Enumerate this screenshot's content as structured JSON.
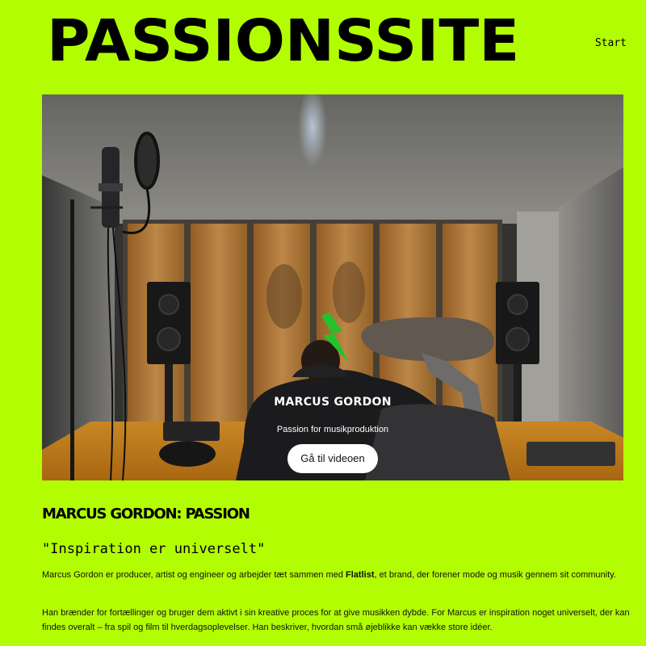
{
  "header": {
    "logo_text": "PASSIONSSITE",
    "nav_start": "Start"
  },
  "hero": {
    "title": "MARCUS GORDON",
    "subtitle": "Passion for musikproduktion",
    "button_label": "Gå til videoen",
    "icon": "lightning-bolt-icon",
    "image_description_icon": "studio-photo"
  },
  "article": {
    "title": "MARCUS GORDON: PASSION",
    "quote": "\"Inspiration er universelt\"",
    "para1_before": "Marcus Gordon er producer, artist og engineer og arbejder tæt sammen med ",
    "para1_brand": "Flatlist",
    "para1_after": ", et brand, der forener mode og musik gennem sit community.",
    "para2": "Han brænder for fortællinger og bruger dem aktivt i sin kreative proces for at give musikken dybde. For Marcus er inspiration noget universelt, der kan findes overalt – fra spil og film til hverdagsoplevelser. Han beskriver, hvordan små øjeblikke kan vække store idéer."
  },
  "colors": {
    "page_background": "#b3fd03",
    "text": "#000000",
    "button_background": "#ffffff",
    "bolt": "#22c32a"
  }
}
